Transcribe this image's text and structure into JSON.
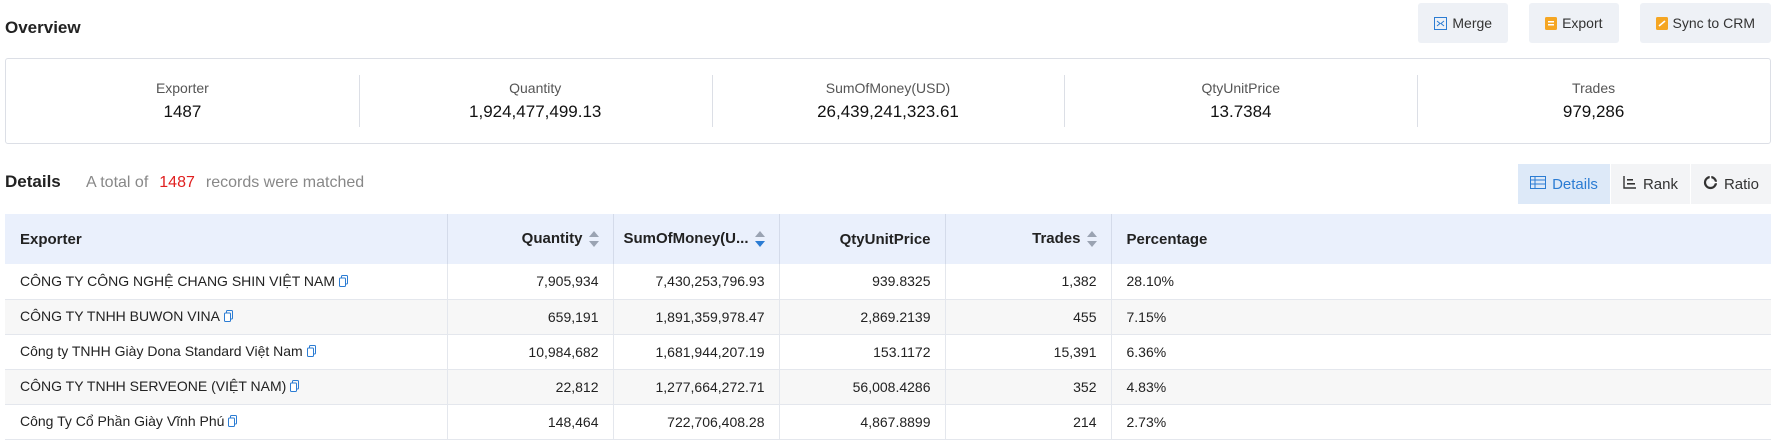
{
  "overview": {
    "title": "Overview"
  },
  "toolbar": {
    "merge_label": "Merge",
    "export_label": "Export",
    "sync_label": "Sync to CRM"
  },
  "summary": {
    "exporter": {
      "label": "Exporter",
      "value": "1487"
    },
    "quantity": {
      "label": "Quantity",
      "value": "1,924,477,499.13"
    },
    "sum_of_money": {
      "label": "SumOfMoney(USD)",
      "value": "26,439,241,323.61"
    },
    "qty_unit_price": {
      "label": "QtyUnitPrice",
      "value": "13.7384"
    },
    "trades": {
      "label": "Trades",
      "value": "979,286"
    }
  },
  "details": {
    "title": "Details",
    "prefix": "A total of",
    "count": "1487",
    "suffix": "records were matched"
  },
  "view_switch": {
    "details": "Details",
    "rank": "Rank",
    "ratio": "Ratio"
  },
  "table": {
    "headers": {
      "exporter": "Exporter",
      "quantity": "Quantity",
      "sum_of_money": "SumOfMoney(U...",
      "qty_unit_price": "QtyUnitPrice",
      "trades": "Trades",
      "percentage": "Percentage"
    },
    "rows": [
      {
        "exporter": "CÔNG TY CÔNG NGHỆ CHANG SHIN VIỆT NAM",
        "quantity": "7,905,934",
        "sum": "7,430,253,796.93",
        "unit_price": "939.8325",
        "trades": "1,382",
        "percentage": "28.10%"
      },
      {
        "exporter": "CÔNG TY TNHH BUWON VINA",
        "quantity": "659,191",
        "sum": "1,891,359,978.47",
        "unit_price": "2,869.2139",
        "trades": "455",
        "percentage": "7.15%"
      },
      {
        "exporter": "Công ty TNHH Giày Dona Standard Việt Nam",
        "quantity": "10,984,682",
        "sum": "1,681,944,207.19",
        "unit_price": "153.1172",
        "trades": "15,391",
        "percentage": "6.36%"
      },
      {
        "exporter": "CÔNG TY TNHH SERVEONE (VIỆT NAM)",
        "quantity": "22,812",
        "sum": "1,277,664,272.71",
        "unit_price": "56,008.4286",
        "trades": "352",
        "percentage": "4.83%"
      },
      {
        "exporter": "Công Ty Cổ Phần Giày Vĩnh Phú",
        "quantity": "148,464",
        "sum": "722,706,408.28",
        "unit_price": "4,867.8899",
        "trades": "214",
        "percentage": "2.73%"
      }
    ]
  },
  "colors": {
    "accent": "#2b7cd3",
    "count_red": "#e02020",
    "header_bg": "#eaf0fc",
    "toolbar_icon": "#f5a623"
  },
  "icons": {
    "merge": "merge-icon",
    "export": "export-icon",
    "sync": "crm-sync-icon",
    "copy": "copy-icon",
    "details": "table-icon",
    "rank": "rank-icon",
    "ratio": "ratio-icon"
  }
}
